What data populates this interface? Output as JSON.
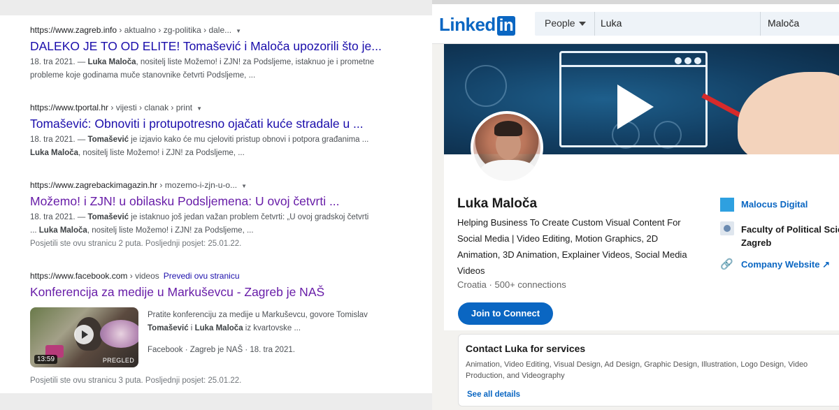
{
  "search_results": [
    {
      "url_host": "https://www.zagreb.info",
      "url_path": " › aktualno › zg-politika › dale...",
      "title": "DALEKO JE TO OD ELITE! Tomašević i Maloča upozorili što je...",
      "snippet_line1_pre": "18. tra 2021. — ",
      "snippet_line1_bold": "Luka Maloča",
      "snippet_line1_post": ", nositelj liste Možemo! i ZJN! za Podsljeme, istaknuo je i prometne",
      "snippet_line2": "probleme koje godinama muče stanovnike četvrti Podsljeme, ..."
    },
    {
      "url_host": "https://www.tportal.hr",
      "url_path": " › vijesti › clanak › print",
      "title": "Tomašević: Obnoviti i protupotresno ojačati kuće stradale u ...",
      "snippet_line1_pre": "18. tra 2021. — ",
      "snippet_line1_bold": "Tomašević",
      "snippet_line1_post": " je izjavio kako će mu cjeloviti pristup obnovi i potpora građanima ...",
      "snippet_line2_bold": "Luka Maloča",
      "snippet_line2_post": ", nositelj liste Možemo! i ZJN! za Podsljeme, ..."
    },
    {
      "url_host": "https://www.zagrebackimagazin.hr",
      "url_path": " › mozemo-i-zjn-u-o...",
      "title": "Možemo! i ZJN! u obilasku Podsljemena: U ovoj četvrti ...",
      "snippet_line1_pre": "18. tra 2021. — ",
      "snippet_line1_bold": "Tomašević",
      "snippet_line1_post": " je istaknuo još jedan važan problem četvrti: „U ovoj gradskoj četvrti",
      "snippet_line2_pre": "... ",
      "snippet_line2_bold": "Luka Maloča",
      "snippet_line2_post": ", nositelj liste Možemo! i ZJN! za Podsljeme, ...",
      "visited": "Posjetili ste ovu stranicu 2 puta. Posljednji posjet: 25.01.22."
    },
    {
      "url_host": "https://www.facebook.com",
      "url_path": " › videos",
      "translate": "Prevedi ovu stranicu",
      "title": "Konferencija za medije u Markuševcu - Zagreb je NAŠ",
      "video_text_line1": "Pratite konferenciju za medije u Markuševcu, govore Tomislav",
      "video_text_bold1": "Tomašević",
      "video_text_mid": " i ",
      "video_text_bold2": "Luka Maloča",
      "video_text_post": " iz kvartovske ...",
      "video_meta": "Facebook · Zagreb je NAŠ · 18. tra 2021.",
      "duration": "13:59",
      "preview_label": "PREGLED",
      "visited": "Posjetili ste ovu stranicu 3 puta. Posljednji posjet: 25.01.22."
    }
  ],
  "linkedin": {
    "logo_text": "Linked",
    "logo_in": "in",
    "search_scope": "People",
    "first_name": "Luka",
    "last_name": "Maloča",
    "profile_name": "Luka Maloča",
    "headline": "Helping Business To Create Custom Visual Content For Social Media | Video Editing, Motion Graphics, 2D Animation, 3D Animation, Explainer Videos, Social Media Videos",
    "location": "Croatia",
    "connections": "500+ connections",
    "join_button": "Join to Connect",
    "company": "Malocus Digital",
    "school_line1": "Faculty of Political Scie",
    "school_line2": "Zagreb",
    "company_website": "Company Website",
    "services_title": "Contact Luka for services",
    "services_list": "Animation, Video Editing, Visual Design, Ad Design, Graphic Design, Illustration, Logo Design, Video Production, and Videography",
    "see_all": "See all details",
    "colors": {
      "brand": "#0a66c2"
    }
  }
}
